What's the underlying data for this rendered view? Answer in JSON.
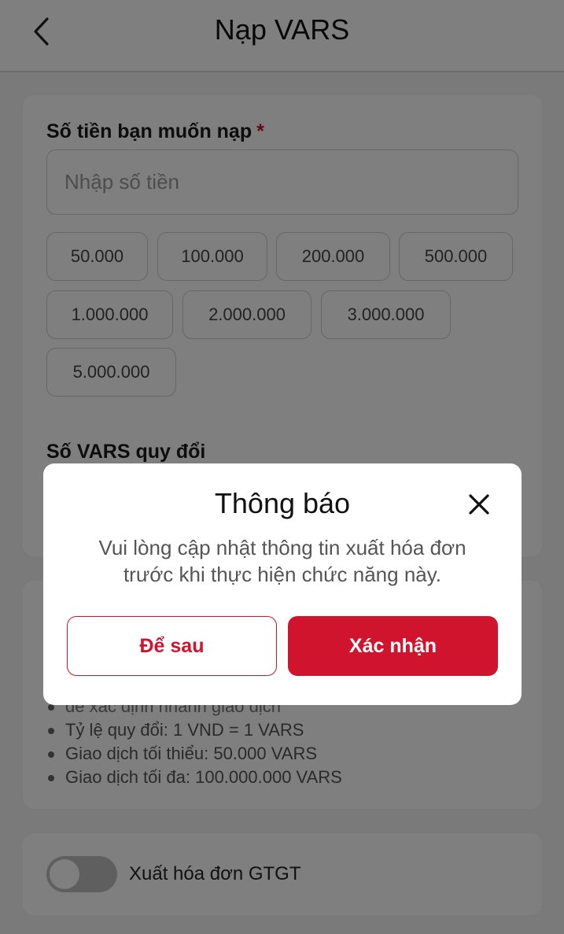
{
  "header": {
    "title": "Nạp VARS",
    "back_icon": "chevron-left-icon"
  },
  "topup": {
    "amount_label": "Số tiền bạn muốn nạp",
    "required_mark": "*",
    "amount_placeholder": "Nhập số tiền",
    "amount_value": "",
    "presets": [
      "50.000",
      "100.000",
      "200.000",
      "500.000",
      "1.000.000",
      "2.000.000",
      "3.000.000",
      "5.000.000"
    ],
    "vars_label": "Số VARS quy đổi"
  },
  "notes": {
    "partial_line": "để xác định nhanh giao dịch",
    "items": [
      "Tỷ lệ quy đổi: 1 VND = 1 VARS",
      "Giao dịch tối thiểu: 50.000 VARS",
      "Giao dịch tối đa: 100.000.000 VARS"
    ]
  },
  "invoice": {
    "toggle_label": "Xuất hóa đơn GTGT",
    "toggle_on": false
  },
  "modal": {
    "title": "Thông báo",
    "message_line1": "Vui lòng cập nhật thông tin xuất hóa đơn",
    "message_line2": "trước khi thực hiện chức năng này.",
    "later_label": "Để sau",
    "confirm_label": "Xác nhận",
    "close_icon": "close-icon"
  },
  "colors": {
    "accent": "#d0142d",
    "background": "#f4f4f4",
    "overlay": "rgba(0,0,0,0.5)"
  }
}
